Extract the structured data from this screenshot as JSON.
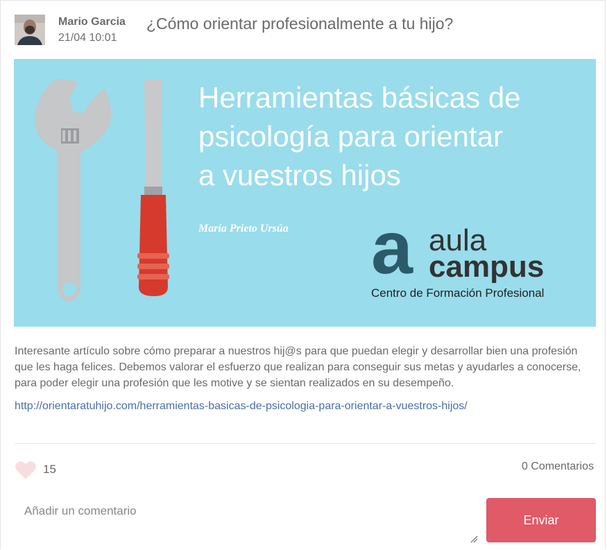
{
  "post": {
    "author_name": "Mario Garcia",
    "date": "21/04 10:01",
    "title": "¿Cómo orientar profesionalmente a tu hijo?",
    "description": "Interesante artículo sobre cómo preparar a nuestros hij@s para que puedan elegir y desarrollar bien una profesión que les haga felices. Debemos valorar el esfuerzo que realizan para conseguir sus metas y ayudarles a conocerse, para poder elegir una profesión que les motive y se sientan realizados en su desempeño.",
    "link": "http://orientaratuhijo.com/herramientas-basicas-de-psicologia-para-orientar-a-vuestros-hijos/"
  },
  "banner": {
    "heading": "Herramientas básicas de\npsicología para orientar\na vuestros  hijos",
    "author": "María Prieto Ursúa",
    "logo_letter": "a",
    "logo_word1": "aula",
    "logo_word2": "campus",
    "logo_tagline": "Centro de Formación Profesional",
    "background_color": "#99dcec"
  },
  "actions": {
    "like_icon": "heart-icon",
    "like_count": "15",
    "comments_label": "0 Comentarios"
  },
  "comment_form": {
    "placeholder": "Añadir un comentario",
    "value": "",
    "send_label": "Enviar",
    "send_color": "#e05a68"
  }
}
